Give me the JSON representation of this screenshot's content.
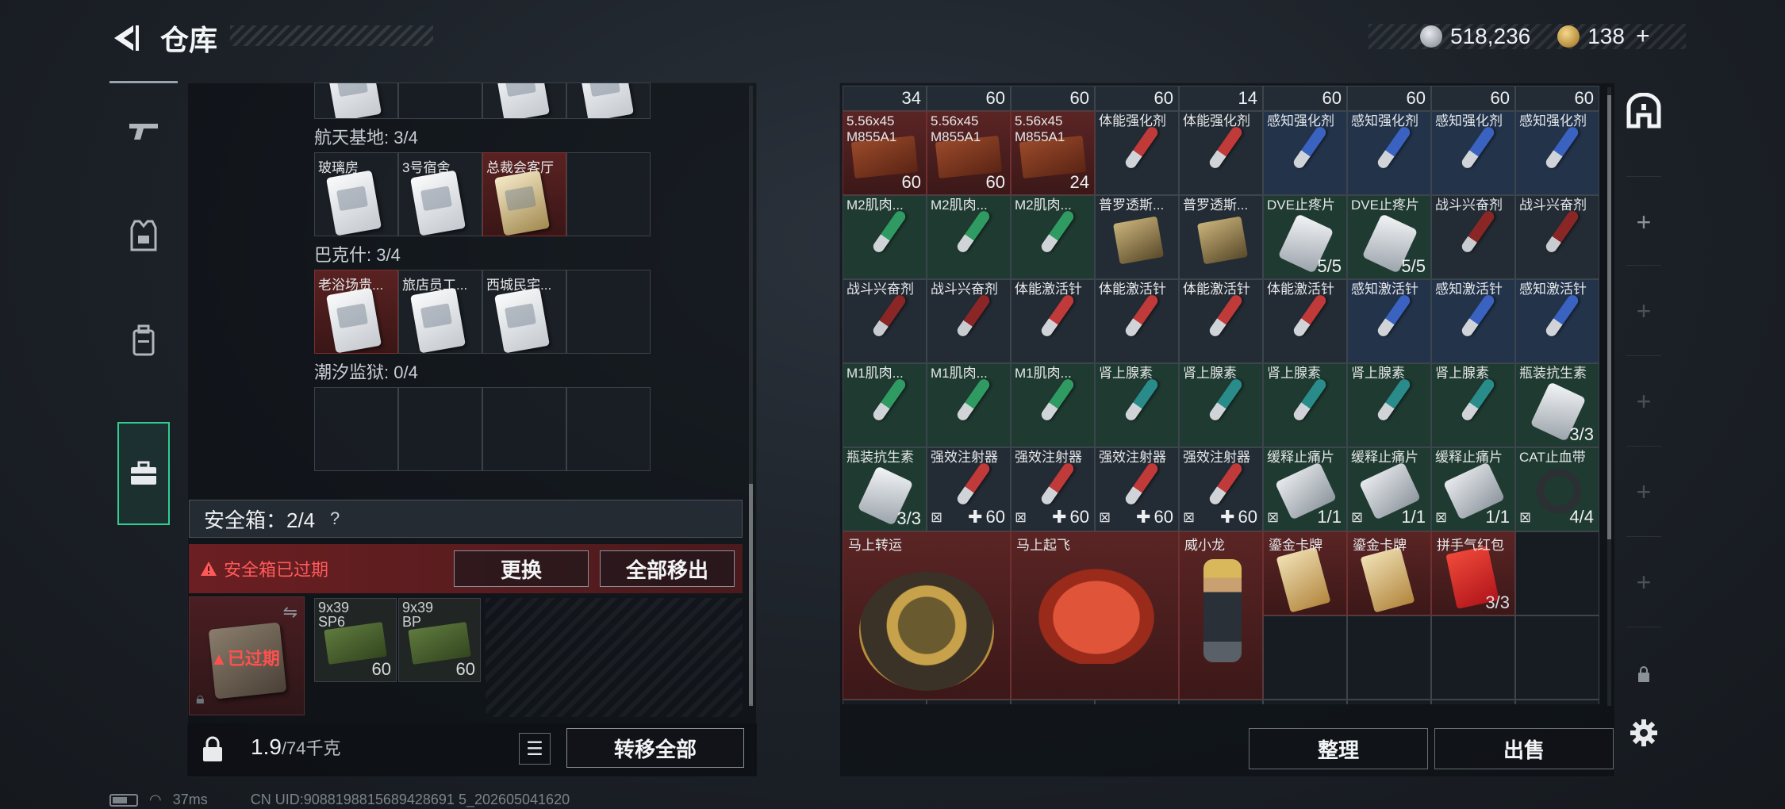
{
  "header": {
    "title": "仓库",
    "silver_amount": "518,236",
    "gold_amount": "138",
    "gold_plus": "+"
  },
  "left_nav": {
    "icons": [
      "gun-icon",
      "armor-icon",
      "backpack-icon",
      "toolbox-icon"
    ],
    "active_index": 3
  },
  "warehouse_groups": {
    "top_counts": [
      "",
      "",
      "",
      ""
    ],
    "groups": [
      {
        "label": "航天基地: 3/4",
        "slots": [
          "玻璃房",
          "3号宿舍",
          "总裁会客厅",
          ""
        ]
      },
      {
        "label": "巴克什: 3/4",
        "slots": [
          "老浴场贵...",
          "旅店员工...",
          "西城民宅...",
          ""
        ]
      },
      {
        "label": "潮汐监狱: 0/4",
        "slots": [
          "",
          "",
          "",
          ""
        ]
      }
    ]
  },
  "safe_box": {
    "label": "安全箱：2/4",
    "help": "?",
    "expired_notice": "安全箱已过期",
    "replace_button": "更换",
    "remove_all_button": "全部移出",
    "box_status": "已过期",
    "items": [
      {
        "name": "9x39\nSP6",
        "count": "60"
      },
      {
        "name": "9x39\nBP",
        "count": "60"
      }
    ]
  },
  "bottom_left": {
    "weight_value": "1.9",
    "weight_max": "/74千克",
    "transfer_all_button": "转移全部"
  },
  "grid": {
    "top_partial_counts": [
      "34",
      "60",
      "60",
      "60",
      "14",
      "60",
      "60",
      "60",
      "60"
    ],
    "rows": [
      [
        {
          "name": "5.56x45\nM855A1",
          "count": "60",
          "kind": "ammo"
        },
        {
          "name": "5.56x45\nM855A1",
          "count": "60",
          "kind": "ammo"
        },
        {
          "name": "5.56x45\nM855A1",
          "count": "24",
          "kind": "ammo"
        },
        {
          "name": "体能强化剂",
          "count": "",
          "kind": "syringe-red"
        },
        {
          "name": "体能强化剂",
          "count": "",
          "kind": "syringe-red"
        },
        {
          "name": "感知强化剂",
          "count": "",
          "kind": "syringe-blue"
        },
        {
          "name": "感知强化剂",
          "count": "",
          "kind": "syringe-blue"
        },
        {
          "name": "感知强化剂",
          "count": "",
          "kind": "syringe-blue"
        },
        {
          "name": "感知强化剂",
          "count": "",
          "kind": "syringe-blue"
        }
      ],
      [
        {
          "name": "M2肌肉...",
          "count": "",
          "kind": "syringe-green"
        },
        {
          "name": "M2肌肉...",
          "count": "",
          "kind": "syringe-green"
        },
        {
          "name": "M2肌肉...",
          "count": "",
          "kind": "syringe-green"
        },
        {
          "name": "普罗透斯...",
          "count": "",
          "kind": "kit"
        },
        {
          "name": "普罗透斯...",
          "count": "",
          "kind": "kit"
        },
        {
          "name": "DVE止疼片",
          "count": "5/5",
          "kind": "pills"
        },
        {
          "name": "DVE止疼片",
          "count": "5/5",
          "kind": "pills"
        },
        {
          "name": "战斗兴奋剂",
          "count": "",
          "kind": "syringe-darkred"
        },
        {
          "name": "战斗兴奋剂",
          "count": "",
          "kind": "syringe-darkred"
        }
      ],
      [
        {
          "name": "战斗兴奋剂",
          "count": "",
          "kind": "syringe-darkred"
        },
        {
          "name": "战斗兴奋剂",
          "count": "",
          "kind": "syringe-darkred"
        },
        {
          "name": "体能激活针",
          "count": "",
          "kind": "syringe-red"
        },
        {
          "name": "体能激活针",
          "count": "",
          "kind": "syringe-red"
        },
        {
          "name": "体能激活针",
          "count": "",
          "kind": "syringe-red"
        },
        {
          "name": "体能激活针",
          "count": "",
          "kind": "syringe-red"
        },
        {
          "name": "感知激活针",
          "count": "",
          "kind": "syringe-blue"
        },
        {
          "name": "感知激活针",
          "count": "",
          "kind": "syringe-blue"
        },
        {
          "name": "感知激活针",
          "count": "",
          "kind": "syringe-blue"
        }
      ],
      [
        {
          "name": "M1肌肉...",
          "count": "",
          "kind": "syringe-green"
        },
        {
          "name": "M1肌肉...",
          "count": "",
          "kind": "syringe-green"
        },
        {
          "name": "M1肌肉...",
          "count": "",
          "kind": "syringe-green"
        },
        {
          "name": "肾上腺素",
          "count": "",
          "kind": "syringe-teal"
        },
        {
          "name": "肾上腺素",
          "count": "",
          "kind": "syringe-teal"
        },
        {
          "name": "肾上腺素",
          "count": "",
          "kind": "syringe-teal"
        },
        {
          "name": "肾上腺素",
          "count": "",
          "kind": "syringe-teal"
        },
        {
          "name": "肾上腺素",
          "count": "",
          "kind": "syringe-teal"
        },
        {
          "name": "瓶装抗生素",
          "count": "3/3",
          "kind": "bottle"
        }
      ],
      [
        {
          "name": "瓶装抗生素",
          "count": "3/3",
          "kind": "bottle"
        },
        {
          "name": "强效注射器",
          "count": "60",
          "kind": "syringe-red",
          "flags": true
        },
        {
          "name": "强效注射器",
          "count": "60",
          "kind": "syringe-red",
          "flags": true
        },
        {
          "name": "强效注射器",
          "count": "60",
          "kind": "syringe-red",
          "flags": true
        },
        {
          "name": "强效注射器",
          "count": "60",
          "kind": "syringe-red",
          "flags": true
        },
        {
          "name": "缓释止痛片",
          "count": "1/1",
          "kind": "pillpack",
          "flags": true
        },
        {
          "name": "缓释止痛片",
          "count": "1/1",
          "kind": "pillpack",
          "flags": true
        },
        {
          "name": "缓释止痛片",
          "count": "1/1",
          "kind": "pillpack",
          "flags": true
        },
        {
          "name": "CAT止血带",
          "count": "4/4",
          "kind": "tourniquet",
          "flags": true
        }
      ]
    ],
    "collectibles": [
      {
        "name": "马上转运",
        "kind": "medal"
      },
      {
        "name": "马上起飞",
        "kind": "horse"
      },
      {
        "name": "威小龙",
        "kind": "character"
      },
      {
        "name": "鎏金卡牌",
        "kind": "card"
      },
      {
        "name": "鎏金卡牌",
        "kind": "card"
      },
      {
        "name": "拼手气红包",
        "kind": "envelope",
        "count": "3/3"
      }
    ]
  },
  "right_actions": {
    "sort_button": "整理",
    "sell_button": "出售"
  },
  "status_bar": {
    "ping": "37ms",
    "uid": "CN UID:9088198815689428691 5_202605041620"
  },
  "colors": {
    "accent": "#2fd08f",
    "warning": "#ff5a5a",
    "red_cell": "#5a2424"
  }
}
